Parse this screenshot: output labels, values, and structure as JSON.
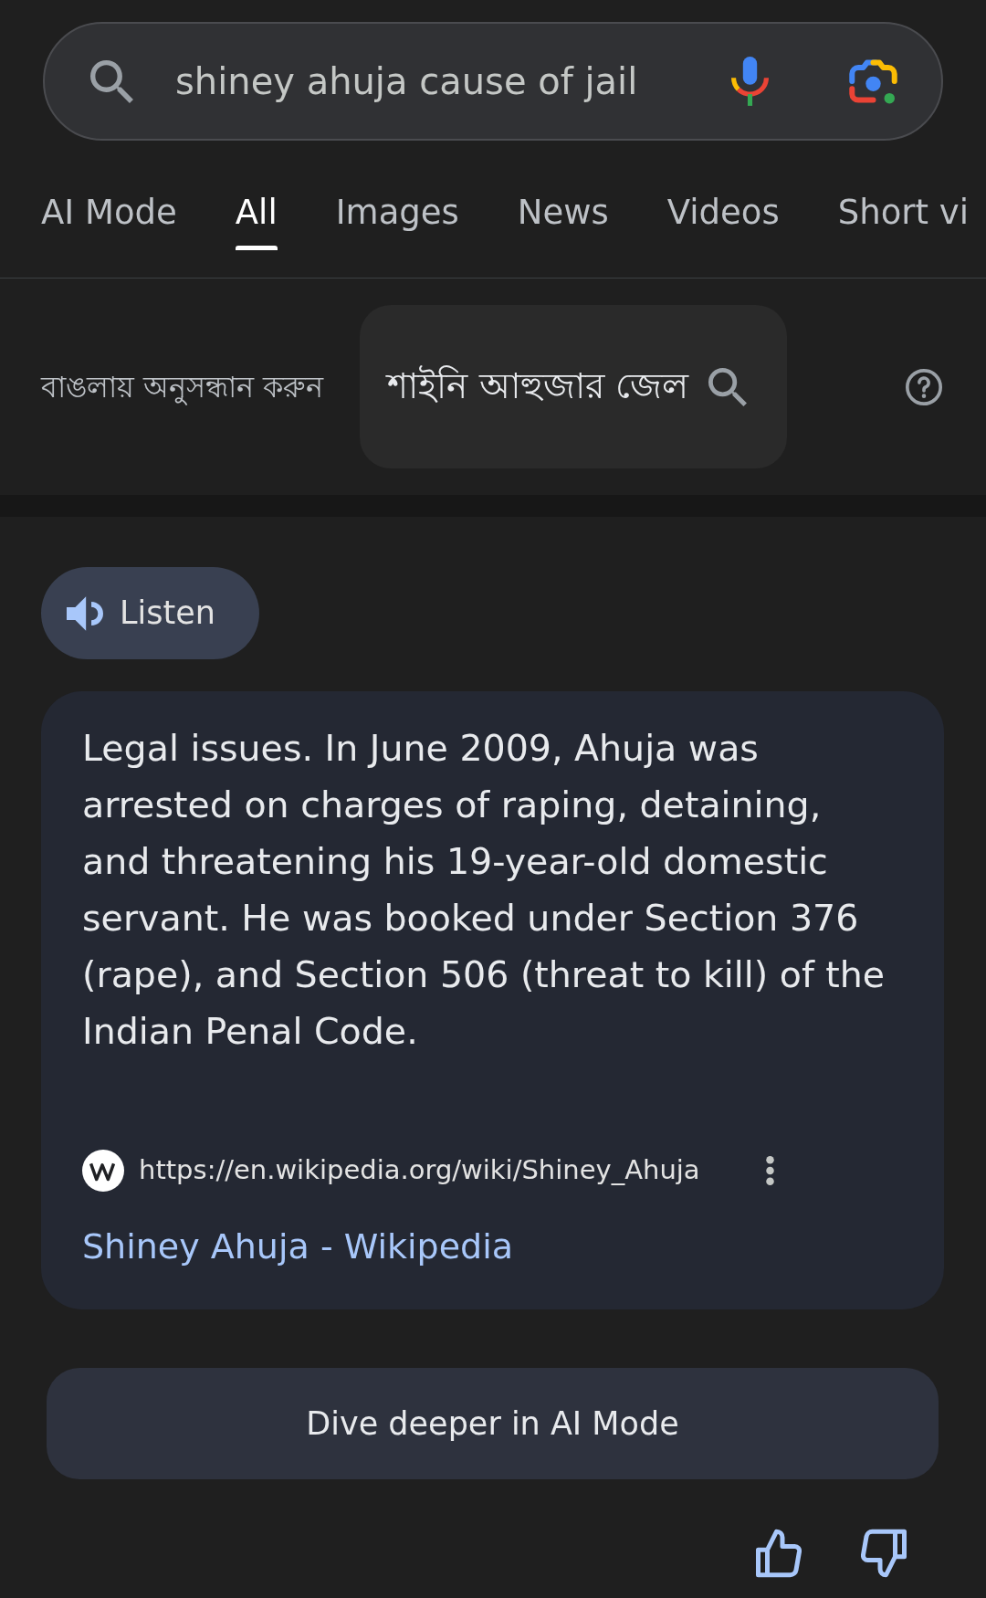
{
  "search": {
    "query": "shiney ahuja cause of jail"
  },
  "tabs": [
    {
      "label": "AI Mode",
      "selected": false
    },
    {
      "label": "All",
      "selected": true
    },
    {
      "label": "Images",
      "selected": false
    },
    {
      "label": "News",
      "selected": false
    },
    {
      "label": "Videos",
      "selected": false
    },
    {
      "label": "Short vi",
      "selected": false
    }
  ],
  "translate_bar": {
    "label": "বাঙলায় অনুসন্ধান করুন",
    "suggestion": "শাইনি আহুজার জেল"
  },
  "listen_button": {
    "label": "Listen"
  },
  "answer": {
    "text": "Legal issues. In June 2009, Ahuja was arrested on charges of raping, detaining, and threatening his 19-year-old domestic servant. He was booked under Section 376 (rape), and Section 506 (threat to kill) of the Indian Penal Code.",
    "source": {
      "url": "https://en.wikipedia.org/wiki/Shiney_Ahuja",
      "title": "Shiney Ahuja - Wikipedia"
    }
  },
  "ai_mode_button": {
    "label": "Dive deeper in AI Mode"
  }
}
